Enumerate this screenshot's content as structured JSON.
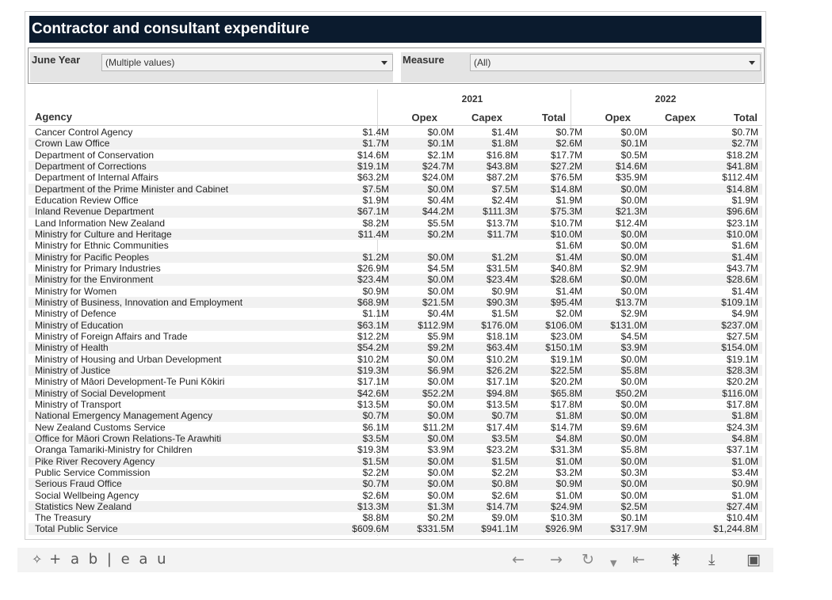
{
  "title": "Contractor and consultant expenditure",
  "filters": {
    "year_label": "June Year",
    "year_value": "(Multiple values)",
    "measure_label": "Measure",
    "measure_value": "(All)"
  },
  "table": {
    "agency_header": "Agency",
    "years": [
      "2021",
      "2022"
    ],
    "columns": [
      "Opex",
      "Capex",
      "Total",
      "Opex",
      "Capex",
      "Total"
    ],
    "rows": [
      [
        "Cancer Control Agency",
        "$1.4M",
        "$0.0M",
        "$1.4M",
        "$0.7M",
        "$0.0M",
        "$0.7M"
      ],
      [
        "Crown Law Office",
        "$1.7M",
        "$0.1M",
        "$1.8M",
        "$2.6M",
        "$0.1M",
        "$2.7M"
      ],
      [
        "Department of Conservation",
        "$14.6M",
        "$2.1M",
        "$16.8M",
        "$17.7M",
        "$0.5M",
        "$18.2M"
      ],
      [
        "Department of Corrections",
        "$19.1M",
        "$24.7M",
        "$43.8M",
        "$27.2M",
        "$14.6M",
        "$41.8M"
      ],
      [
        "Department of Internal Affairs",
        "$63.2M",
        "$24.0M",
        "$87.2M",
        "$76.5M",
        "$35.9M",
        "$112.4M"
      ],
      [
        "Department of the Prime Minister and Cabinet",
        "$7.5M",
        "$0.0M",
        "$7.5M",
        "$14.8M",
        "$0.0M",
        "$14.8M"
      ],
      [
        "Education Review Office",
        "$1.9M",
        "$0.4M",
        "$2.4M",
        "$1.9M",
        "$0.0M",
        "$1.9M"
      ],
      [
        "Inland Revenue Department",
        "$67.1M",
        "$44.2M",
        "$111.3M",
        "$75.3M",
        "$21.3M",
        "$96.6M"
      ],
      [
        "Land Information New Zealand",
        "$8.2M",
        "$5.5M",
        "$13.7M",
        "$10.7M",
        "$12.4M",
        "$23.1M"
      ],
      [
        "Ministry for Culture and Heritage",
        "$11.4M",
        "$0.2M",
        "$11.7M",
        "$10.0M",
        "$0.0M",
        "$10.0M"
      ],
      [
        "Ministry for Ethnic Communities",
        "",
        "",
        "",
        "$1.6M",
        "$0.0M",
        "$1.6M"
      ],
      [
        "Ministry for Pacific Peoples",
        "$1.2M",
        "$0.0M",
        "$1.2M",
        "$1.4M",
        "$0.0M",
        "$1.4M"
      ],
      [
        "Ministry for Primary Industries",
        "$26.9M",
        "$4.5M",
        "$31.5M",
        "$40.8M",
        "$2.9M",
        "$43.7M"
      ],
      [
        "Ministry for the Environment",
        "$23.4M",
        "$0.0M",
        "$23.4M",
        "$28.6M",
        "$0.0M",
        "$28.6M"
      ],
      [
        "Ministry for Women",
        "$0.9M",
        "$0.0M",
        "$0.9M",
        "$1.4M",
        "$0.0M",
        "$1.4M"
      ],
      [
        "Ministry of Business, Innovation and Employment",
        "$68.9M",
        "$21.5M",
        "$90.3M",
        "$95.4M",
        "$13.7M",
        "$109.1M"
      ],
      [
        "Ministry of Defence",
        "$1.1M",
        "$0.4M",
        "$1.5M",
        "$2.0M",
        "$2.9M",
        "$4.9M"
      ],
      [
        "Ministry of Education",
        "$63.1M",
        "$112.9M",
        "$176.0M",
        "$106.0M",
        "$131.0M",
        "$237.0M"
      ],
      [
        "Ministry of Foreign Affairs and Trade",
        "$12.2M",
        "$5.9M",
        "$18.1M",
        "$23.0M",
        "$4.5M",
        "$27.5M"
      ],
      [
        "Ministry of Health",
        "$54.2M",
        "$9.2M",
        "$63.4M",
        "$150.1M",
        "$3.9M",
        "$154.0M"
      ],
      [
        "Ministry of Housing and Urban Development",
        "$10.2M",
        "$0.0M",
        "$10.2M",
        "$19.1M",
        "$0.0M",
        "$19.1M"
      ],
      [
        "Ministry of Justice",
        "$19.3M",
        "$6.9M",
        "$26.2M",
        "$22.5M",
        "$5.8M",
        "$28.3M"
      ],
      [
        "Ministry of Māori Development-Te Puni Kōkiri",
        "$17.1M",
        "$0.0M",
        "$17.1M",
        "$20.2M",
        "$0.0M",
        "$20.2M"
      ],
      [
        "Ministry of Social Development",
        "$42.6M",
        "$52.2M",
        "$94.8M",
        "$65.8M",
        "$50.2M",
        "$116.0M"
      ],
      [
        "Ministry of Transport",
        "$13.5M",
        "$0.0M",
        "$13.5M",
        "$17.8M",
        "$0.0M",
        "$17.8M"
      ],
      [
        "National Emergency Management Agency",
        "$0.7M",
        "$0.0M",
        "$0.7M",
        "$1.8M",
        "$0.0M",
        "$1.8M"
      ],
      [
        "New Zealand Customs Service",
        "$6.1M",
        "$11.2M",
        "$17.4M",
        "$14.7M",
        "$9.6M",
        "$24.3M"
      ],
      [
        "Office for Māori Crown Relations-Te Arawhiti",
        "$3.5M",
        "$0.0M",
        "$3.5M",
        "$4.8M",
        "$0.0M",
        "$4.8M"
      ],
      [
        "Oranga Tamariki-Ministry for Children",
        "$19.3M",
        "$3.9M",
        "$23.2M",
        "$31.3M",
        "$5.8M",
        "$37.1M"
      ],
      [
        "Pike River Recovery Agency",
        "$1.5M",
        "$0.0M",
        "$1.5M",
        "$1.0M",
        "$0.0M",
        "$1.0M"
      ],
      [
        "Public Service Commission",
        "$2.2M",
        "$0.0M",
        "$2.2M",
        "$3.2M",
        "$0.3M",
        "$3.4M"
      ],
      [
        "Serious Fraud Office",
        "$0.7M",
        "$0.0M",
        "$0.8M",
        "$0.9M",
        "$0.0M",
        "$0.9M"
      ],
      [
        "Social Wellbeing Agency",
        "$2.6M",
        "$0.0M",
        "$2.6M",
        "$1.0M",
        "$0.0M",
        "$1.0M"
      ],
      [
        "Statistics New Zealand",
        "$13.3M",
        "$1.3M",
        "$14.7M",
        "$24.9M",
        "$2.5M",
        "$27.4M"
      ],
      [
        "The Treasury",
        "$8.8M",
        "$0.2M",
        "$9.0M",
        "$10.3M",
        "$0.1M",
        "$10.4M"
      ],
      [
        "Total Public Service",
        "$609.6M",
        "$331.5M",
        "$941.1M",
        "$926.9M",
        "$317.9M",
        "$1,244.8M"
      ]
    ]
  },
  "toolbar": {
    "logo_text": "+ a b | e a u",
    "icons": [
      "tableau-logo-icon",
      "undo-icon",
      "redo-icon",
      "revert-icon",
      "revert-dropdown-icon",
      "reset-icon",
      "share-icon",
      "download-icon",
      "fullscreen-icon"
    ]
  }
}
